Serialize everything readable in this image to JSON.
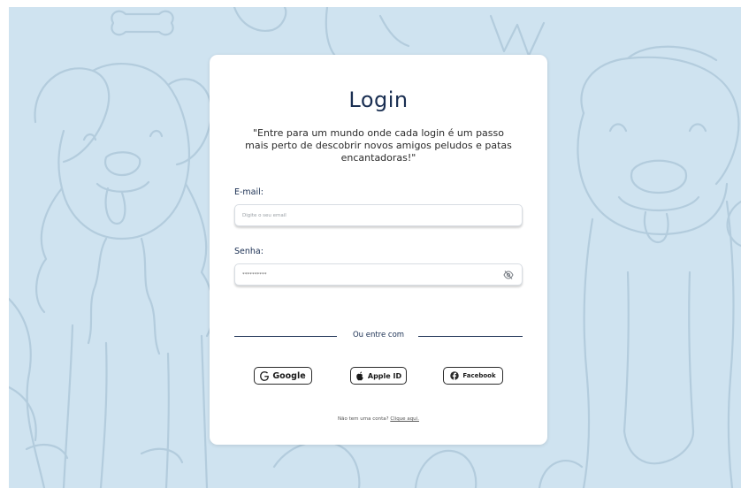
{
  "login": {
    "title": "Login",
    "tagline": "\"Entre para um mundo onde cada login é um passo mais perto de descobrir novos amigos peludos e patas encantadoras!\"",
    "email_label": "E-mail:",
    "email_placeholder": "Digite o seu email",
    "password_label": "Senha:",
    "password_value": "**********",
    "divider_text": "Ou entre com",
    "google_label": "Google",
    "apple_label": "Apple ID",
    "facebook_label": "Facebook",
    "signup_text": "Não tem uma conta?",
    "signup_link": "Clique aqui."
  },
  "colors": {
    "background": "#cfe3f0",
    "card": "#ffffff",
    "primary_text": "#1a2f52",
    "facebook_icon": "#2a2a2a"
  },
  "icons": {
    "password_toggle": "eye-off-icon",
    "google": "google-g-icon",
    "apple": "apple-icon",
    "facebook": "facebook-icon"
  }
}
